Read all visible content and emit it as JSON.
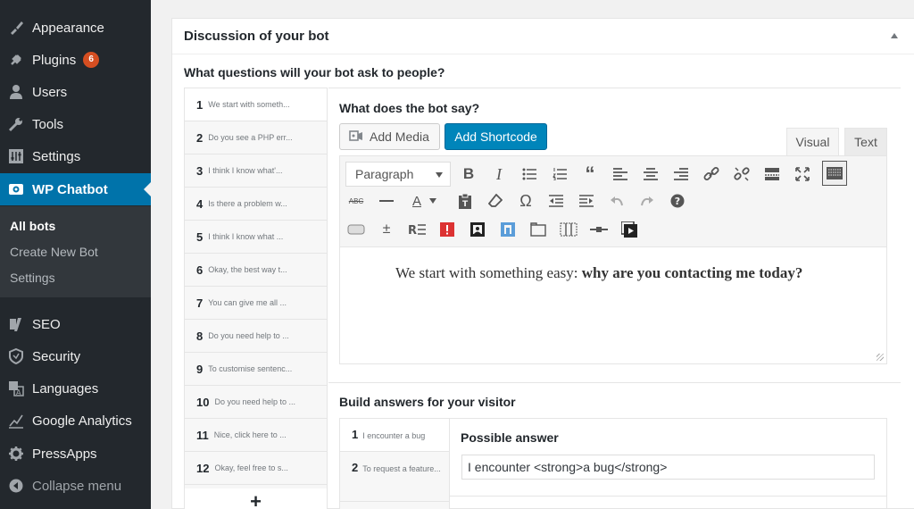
{
  "sidebar": {
    "items": [
      {
        "label": "Appearance",
        "icon": "paintbrush-icon"
      },
      {
        "label": "Plugins",
        "icon": "plugin-icon",
        "badge": "6"
      },
      {
        "label": "Users",
        "icon": "user-icon"
      },
      {
        "label": "Tools",
        "icon": "wrench-icon"
      },
      {
        "label": "Settings",
        "icon": "settings-sliders-icon"
      },
      {
        "label": "WP Chatbot",
        "icon": "chatbot-icon"
      },
      {
        "label": "SEO",
        "icon": "yoast-icon"
      },
      {
        "label": "Security",
        "icon": "shield-icon"
      },
      {
        "label": "Languages",
        "icon": "translate-icon"
      },
      {
        "label": "Google Analytics",
        "icon": "analytics-chart-icon"
      },
      {
        "label": "PressApps",
        "icon": "gear-icon"
      },
      {
        "label": "Collapse menu",
        "icon": "collapse-arrow-icon"
      }
    ],
    "submenu": [
      "All bots",
      "Create New Bot",
      "Settings"
    ]
  },
  "panel": {
    "title": "Discussion of your bot",
    "questions_heading": "What questions will your bot ask to people?",
    "questions": [
      {
        "num": "1",
        "text": "We start with someth..."
      },
      {
        "num": "2",
        "text": "Do you see a PHP err..."
      },
      {
        "num": "3",
        "text": "I think I know what'..."
      },
      {
        "num": "4",
        "text": "Is there a problem w..."
      },
      {
        "num": "5",
        "text": "I think I know what ..."
      },
      {
        "num": "6",
        "text": "Okay, the best way t..."
      },
      {
        "num": "7",
        "text": "You can give me all ..."
      },
      {
        "num": "8",
        "text": "Do you need help to ..."
      },
      {
        "num": "9",
        "text": "To customise sentenc..."
      },
      {
        "num": "10",
        "text": "Do you need help to ..."
      },
      {
        "num": "11",
        "text": "Nice, click here to ..."
      },
      {
        "num": "12",
        "text": "Okay, feel free to s..."
      }
    ],
    "add_symbol": "+"
  },
  "editor": {
    "label": "What does the bot say?",
    "add_media": "Add Media",
    "add_shortcode": "Add Shortcode",
    "tab_visual": "Visual",
    "tab_text": "Text",
    "format_value": "Paragraph",
    "content_plain": "We start with something easy: ",
    "content_bold": "why are you contacting me today?"
  },
  "answers": {
    "heading": "Build answers for your visitor",
    "items": [
      {
        "num": "1",
        "text": "I encounter a bug"
      },
      {
        "num": "2",
        "text": "To request a feature..."
      }
    ],
    "possible_label": "Possible answer",
    "possible_value": "I encounter <strong>a bug</strong>"
  },
  "colors": {
    "sidebar_bg": "#23282d",
    "active_blue": "#0073aa",
    "button_blue": "#0085ba",
    "badge_orange": "#d54e21"
  }
}
